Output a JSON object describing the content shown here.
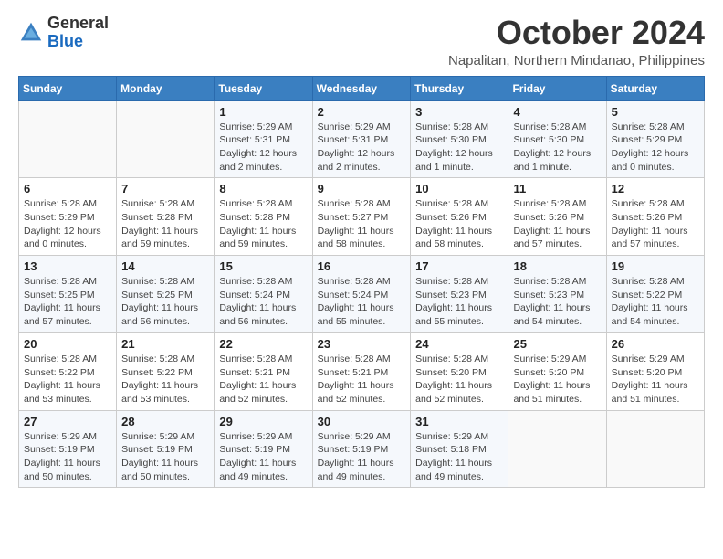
{
  "logo": {
    "general": "General",
    "blue": "Blue"
  },
  "title": "October 2024",
  "location": "Napalitan, Northern Mindanao, Philippines",
  "header": {
    "days": [
      "Sunday",
      "Monday",
      "Tuesday",
      "Wednesday",
      "Thursday",
      "Friday",
      "Saturday"
    ]
  },
  "weeks": [
    [
      {
        "day": "",
        "info": ""
      },
      {
        "day": "",
        "info": ""
      },
      {
        "day": "1",
        "info": "Sunrise: 5:29 AM\nSunset: 5:31 PM\nDaylight: 12 hours and 2 minutes."
      },
      {
        "day": "2",
        "info": "Sunrise: 5:29 AM\nSunset: 5:31 PM\nDaylight: 12 hours and 2 minutes."
      },
      {
        "day": "3",
        "info": "Sunrise: 5:28 AM\nSunset: 5:30 PM\nDaylight: 12 hours and 1 minute."
      },
      {
        "day": "4",
        "info": "Sunrise: 5:28 AM\nSunset: 5:30 PM\nDaylight: 12 hours and 1 minute."
      },
      {
        "day": "5",
        "info": "Sunrise: 5:28 AM\nSunset: 5:29 PM\nDaylight: 12 hours and 0 minutes."
      }
    ],
    [
      {
        "day": "6",
        "info": "Sunrise: 5:28 AM\nSunset: 5:29 PM\nDaylight: 12 hours and 0 minutes."
      },
      {
        "day": "7",
        "info": "Sunrise: 5:28 AM\nSunset: 5:28 PM\nDaylight: 11 hours and 59 minutes."
      },
      {
        "day": "8",
        "info": "Sunrise: 5:28 AM\nSunset: 5:28 PM\nDaylight: 11 hours and 59 minutes."
      },
      {
        "day": "9",
        "info": "Sunrise: 5:28 AM\nSunset: 5:27 PM\nDaylight: 11 hours and 58 minutes."
      },
      {
        "day": "10",
        "info": "Sunrise: 5:28 AM\nSunset: 5:26 PM\nDaylight: 11 hours and 58 minutes."
      },
      {
        "day": "11",
        "info": "Sunrise: 5:28 AM\nSunset: 5:26 PM\nDaylight: 11 hours and 57 minutes."
      },
      {
        "day": "12",
        "info": "Sunrise: 5:28 AM\nSunset: 5:26 PM\nDaylight: 11 hours and 57 minutes."
      }
    ],
    [
      {
        "day": "13",
        "info": "Sunrise: 5:28 AM\nSunset: 5:25 PM\nDaylight: 11 hours and 57 minutes."
      },
      {
        "day": "14",
        "info": "Sunrise: 5:28 AM\nSunset: 5:25 PM\nDaylight: 11 hours and 56 minutes."
      },
      {
        "day": "15",
        "info": "Sunrise: 5:28 AM\nSunset: 5:24 PM\nDaylight: 11 hours and 56 minutes."
      },
      {
        "day": "16",
        "info": "Sunrise: 5:28 AM\nSunset: 5:24 PM\nDaylight: 11 hours and 55 minutes."
      },
      {
        "day": "17",
        "info": "Sunrise: 5:28 AM\nSunset: 5:23 PM\nDaylight: 11 hours and 55 minutes."
      },
      {
        "day": "18",
        "info": "Sunrise: 5:28 AM\nSunset: 5:23 PM\nDaylight: 11 hours and 54 minutes."
      },
      {
        "day": "19",
        "info": "Sunrise: 5:28 AM\nSunset: 5:22 PM\nDaylight: 11 hours and 54 minutes."
      }
    ],
    [
      {
        "day": "20",
        "info": "Sunrise: 5:28 AM\nSunset: 5:22 PM\nDaylight: 11 hours and 53 minutes."
      },
      {
        "day": "21",
        "info": "Sunrise: 5:28 AM\nSunset: 5:22 PM\nDaylight: 11 hours and 53 minutes."
      },
      {
        "day": "22",
        "info": "Sunrise: 5:28 AM\nSunset: 5:21 PM\nDaylight: 11 hours and 52 minutes."
      },
      {
        "day": "23",
        "info": "Sunrise: 5:28 AM\nSunset: 5:21 PM\nDaylight: 11 hours and 52 minutes."
      },
      {
        "day": "24",
        "info": "Sunrise: 5:28 AM\nSunset: 5:20 PM\nDaylight: 11 hours and 52 minutes."
      },
      {
        "day": "25",
        "info": "Sunrise: 5:29 AM\nSunset: 5:20 PM\nDaylight: 11 hours and 51 minutes."
      },
      {
        "day": "26",
        "info": "Sunrise: 5:29 AM\nSunset: 5:20 PM\nDaylight: 11 hours and 51 minutes."
      }
    ],
    [
      {
        "day": "27",
        "info": "Sunrise: 5:29 AM\nSunset: 5:19 PM\nDaylight: 11 hours and 50 minutes."
      },
      {
        "day": "28",
        "info": "Sunrise: 5:29 AM\nSunset: 5:19 PM\nDaylight: 11 hours and 50 minutes."
      },
      {
        "day": "29",
        "info": "Sunrise: 5:29 AM\nSunset: 5:19 PM\nDaylight: 11 hours and 49 minutes."
      },
      {
        "day": "30",
        "info": "Sunrise: 5:29 AM\nSunset: 5:19 PM\nDaylight: 11 hours and 49 minutes."
      },
      {
        "day": "31",
        "info": "Sunrise: 5:29 AM\nSunset: 5:18 PM\nDaylight: 11 hours and 49 minutes."
      },
      {
        "day": "",
        "info": ""
      },
      {
        "day": "",
        "info": ""
      }
    ]
  ]
}
